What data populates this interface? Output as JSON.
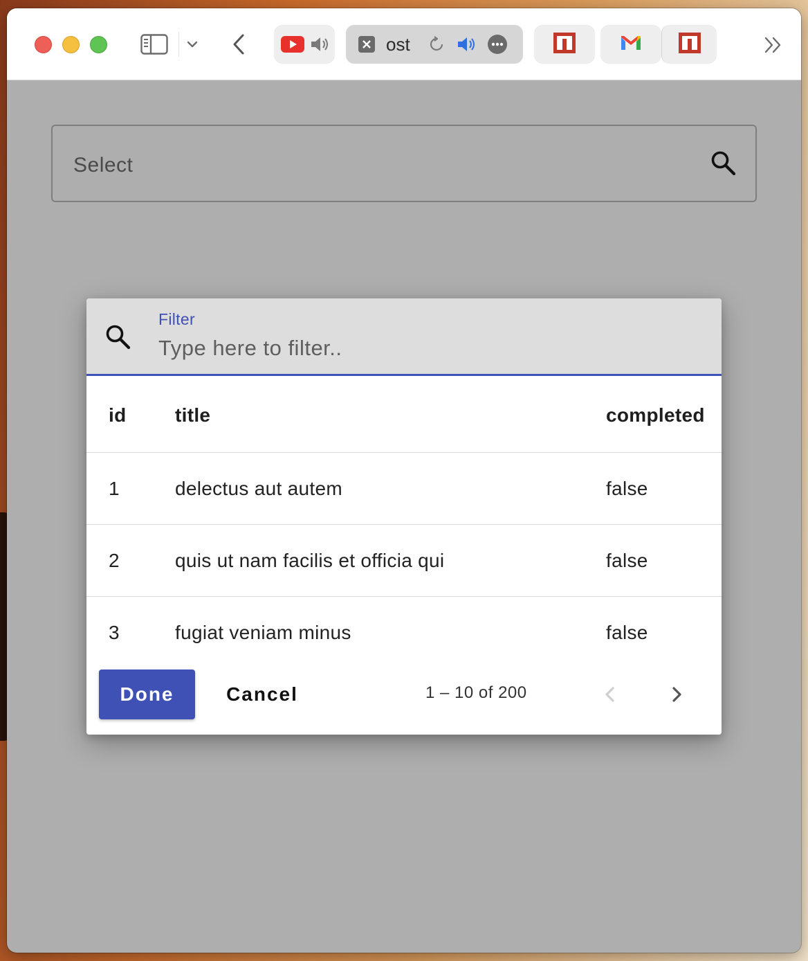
{
  "browser": {
    "tabs": [
      {
        "name": "youtube",
        "icon": "youtube-icon",
        "audio_icon": "speaker-icon"
      },
      {
        "name": "active",
        "title": "ost",
        "icon": "close-icon",
        "reload_icon": "reload-icon",
        "audio_icon": "speaker-active-icon",
        "menu_icon": "more-icon"
      },
      {
        "name": "npm-1",
        "icon": "npm-icon"
      },
      {
        "name": "gmail",
        "icon": "gmail-icon"
      },
      {
        "name": "npm-2",
        "icon": "npm-icon"
      }
    ]
  },
  "select": {
    "label": "Select"
  },
  "dialog": {
    "filter_label": "Filter",
    "filter_placeholder": "Type here to filter..",
    "columns": {
      "id": "id",
      "title": "title",
      "completed": "completed"
    },
    "rows": [
      {
        "id": "1",
        "title": "delectus aut autem",
        "completed": "false"
      },
      {
        "id": "2",
        "title": "quis ut nam facilis et officia qui",
        "completed": "false"
      },
      {
        "id": "3",
        "title": "fugiat veniam minus",
        "completed": "false"
      }
    ],
    "done_label": "Done",
    "cancel_label": "Cancel",
    "page_range": "1 – 10 of 200"
  },
  "colors": {
    "accent": "#3f51b5",
    "traffic_red": "#ee5f57",
    "traffic_yellow": "#f5bf3f",
    "traffic_green": "#5fc454",
    "youtube_red": "#e8312c",
    "npm_red": "#c0392b"
  }
}
